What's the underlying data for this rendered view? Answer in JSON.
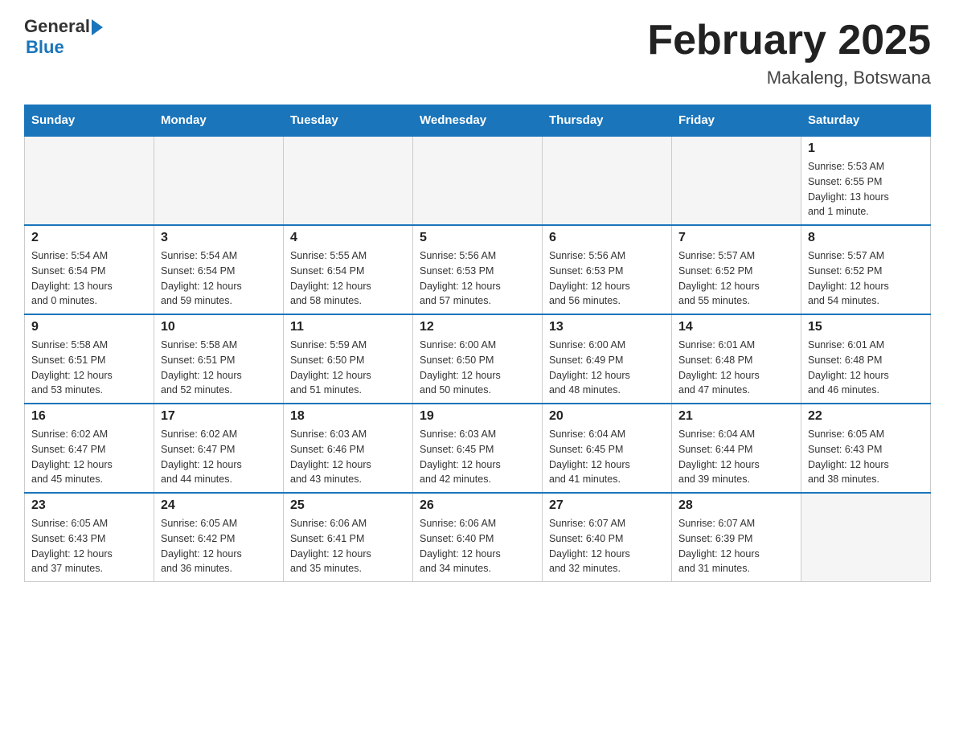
{
  "header": {
    "logo_general": "General",
    "logo_blue": "Blue",
    "title": "February 2025",
    "subtitle": "Makaleng, Botswana"
  },
  "days_of_week": [
    "Sunday",
    "Monday",
    "Tuesday",
    "Wednesday",
    "Thursday",
    "Friday",
    "Saturday"
  ],
  "weeks": [
    [
      {
        "day": "",
        "info": ""
      },
      {
        "day": "",
        "info": ""
      },
      {
        "day": "",
        "info": ""
      },
      {
        "day": "",
        "info": ""
      },
      {
        "day": "",
        "info": ""
      },
      {
        "day": "",
        "info": ""
      },
      {
        "day": "1",
        "info": "Sunrise: 5:53 AM\nSunset: 6:55 PM\nDaylight: 13 hours\nand 1 minute."
      }
    ],
    [
      {
        "day": "2",
        "info": "Sunrise: 5:54 AM\nSunset: 6:54 PM\nDaylight: 13 hours\nand 0 minutes."
      },
      {
        "day": "3",
        "info": "Sunrise: 5:54 AM\nSunset: 6:54 PM\nDaylight: 12 hours\nand 59 minutes."
      },
      {
        "day": "4",
        "info": "Sunrise: 5:55 AM\nSunset: 6:54 PM\nDaylight: 12 hours\nand 58 minutes."
      },
      {
        "day": "5",
        "info": "Sunrise: 5:56 AM\nSunset: 6:53 PM\nDaylight: 12 hours\nand 57 minutes."
      },
      {
        "day": "6",
        "info": "Sunrise: 5:56 AM\nSunset: 6:53 PM\nDaylight: 12 hours\nand 56 minutes."
      },
      {
        "day": "7",
        "info": "Sunrise: 5:57 AM\nSunset: 6:52 PM\nDaylight: 12 hours\nand 55 minutes."
      },
      {
        "day": "8",
        "info": "Sunrise: 5:57 AM\nSunset: 6:52 PM\nDaylight: 12 hours\nand 54 minutes."
      }
    ],
    [
      {
        "day": "9",
        "info": "Sunrise: 5:58 AM\nSunset: 6:51 PM\nDaylight: 12 hours\nand 53 minutes."
      },
      {
        "day": "10",
        "info": "Sunrise: 5:58 AM\nSunset: 6:51 PM\nDaylight: 12 hours\nand 52 minutes."
      },
      {
        "day": "11",
        "info": "Sunrise: 5:59 AM\nSunset: 6:50 PM\nDaylight: 12 hours\nand 51 minutes."
      },
      {
        "day": "12",
        "info": "Sunrise: 6:00 AM\nSunset: 6:50 PM\nDaylight: 12 hours\nand 50 minutes."
      },
      {
        "day": "13",
        "info": "Sunrise: 6:00 AM\nSunset: 6:49 PM\nDaylight: 12 hours\nand 48 minutes."
      },
      {
        "day": "14",
        "info": "Sunrise: 6:01 AM\nSunset: 6:48 PM\nDaylight: 12 hours\nand 47 minutes."
      },
      {
        "day": "15",
        "info": "Sunrise: 6:01 AM\nSunset: 6:48 PM\nDaylight: 12 hours\nand 46 minutes."
      }
    ],
    [
      {
        "day": "16",
        "info": "Sunrise: 6:02 AM\nSunset: 6:47 PM\nDaylight: 12 hours\nand 45 minutes."
      },
      {
        "day": "17",
        "info": "Sunrise: 6:02 AM\nSunset: 6:47 PM\nDaylight: 12 hours\nand 44 minutes."
      },
      {
        "day": "18",
        "info": "Sunrise: 6:03 AM\nSunset: 6:46 PM\nDaylight: 12 hours\nand 43 minutes."
      },
      {
        "day": "19",
        "info": "Sunrise: 6:03 AM\nSunset: 6:45 PM\nDaylight: 12 hours\nand 42 minutes."
      },
      {
        "day": "20",
        "info": "Sunrise: 6:04 AM\nSunset: 6:45 PM\nDaylight: 12 hours\nand 41 minutes."
      },
      {
        "day": "21",
        "info": "Sunrise: 6:04 AM\nSunset: 6:44 PM\nDaylight: 12 hours\nand 39 minutes."
      },
      {
        "day": "22",
        "info": "Sunrise: 6:05 AM\nSunset: 6:43 PM\nDaylight: 12 hours\nand 38 minutes."
      }
    ],
    [
      {
        "day": "23",
        "info": "Sunrise: 6:05 AM\nSunset: 6:43 PM\nDaylight: 12 hours\nand 37 minutes."
      },
      {
        "day": "24",
        "info": "Sunrise: 6:05 AM\nSunset: 6:42 PM\nDaylight: 12 hours\nand 36 minutes."
      },
      {
        "day": "25",
        "info": "Sunrise: 6:06 AM\nSunset: 6:41 PM\nDaylight: 12 hours\nand 35 minutes."
      },
      {
        "day": "26",
        "info": "Sunrise: 6:06 AM\nSunset: 6:40 PM\nDaylight: 12 hours\nand 34 minutes."
      },
      {
        "day": "27",
        "info": "Sunrise: 6:07 AM\nSunset: 6:40 PM\nDaylight: 12 hours\nand 32 minutes."
      },
      {
        "day": "28",
        "info": "Sunrise: 6:07 AM\nSunset: 6:39 PM\nDaylight: 12 hours\nand 31 minutes."
      },
      {
        "day": "",
        "info": ""
      }
    ]
  ]
}
